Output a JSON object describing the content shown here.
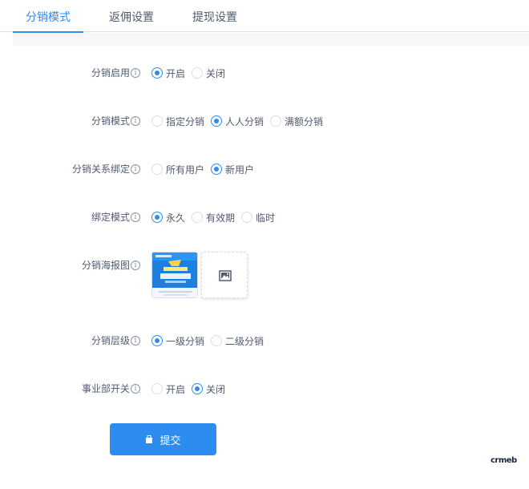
{
  "tabs": [
    {
      "label": "分销模式",
      "active": true
    },
    {
      "label": "返佣设置",
      "active": false
    },
    {
      "label": "提现设置",
      "active": false
    }
  ],
  "form": {
    "fields": [
      {
        "label": "分销启用",
        "options": [
          "开启",
          "关闭"
        ],
        "selected": "开启"
      },
      {
        "label": "分销模式",
        "options": [
          "指定分销",
          "人人分销",
          "满额分销"
        ],
        "selected": "人人分销"
      },
      {
        "label": "分销关系绑定",
        "options": [
          "所有用户",
          "新用户"
        ],
        "selected": "新用户"
      },
      {
        "label": "绑定模式",
        "options": [
          "永久",
          "有效期",
          "临时"
        ],
        "selected": "永久"
      },
      {
        "label": "分销海报图"
      },
      {
        "label": "分销层级",
        "options": [
          "一级分销",
          "二级分销"
        ],
        "selected": "一级分销"
      },
      {
        "label": "事业部开关",
        "options": [
          "开启",
          "关闭"
        ],
        "selected": "关闭"
      }
    ],
    "info_glyph": "i",
    "poster_icon": "poster-thumbnail-image",
    "upload_icon": "image-upload-icon"
  },
  "submit": {
    "label": "提交",
    "icon": "save-icon"
  },
  "brand": {
    "text": "crmeb"
  },
  "colors": {
    "accent": "#2d8cf0",
    "text": "#515a6e",
    "border": "#dcdee2"
  }
}
